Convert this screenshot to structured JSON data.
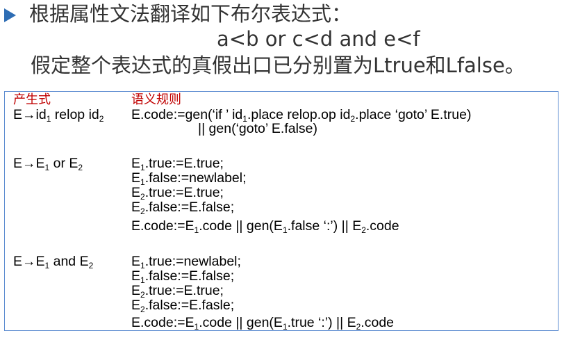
{
  "title": {
    "line1": "根据属性文法翻译如下布尔表达式：",
    "line2": "a<b or c<d and e<f",
    "line3": "假定整个表达式的真假出口已分别置为Ltrue和Lfalse。"
  },
  "table": {
    "header_production": "产生式",
    "header_rules": "语义规则",
    "rows": [
      {
        "production": {
          "a": "E→id",
          "s1": "1",
          "b": " relop id",
          "s2": "2"
        },
        "rules": [
          {
            "a": "E.code:=gen(‘if ’ id",
            "s1": "1",
            "b": ".place relop.op id",
            "s2": "2",
            "c": ".place ‘goto’ E.true)"
          },
          {
            "a": "|| gen(‘goto’  E.false)"
          }
        ]
      },
      {
        "production": {
          "a": "E→E",
          "s1": "1",
          "b": " or E",
          "s2": "2"
        },
        "rules": [
          {
            "a": "E",
            "s1": "1",
            "b": ".true:=E.true;"
          },
          {
            "a": "E",
            "s1": "1",
            "b": ".false:=newlabel;"
          },
          {
            "a": "E",
            "s1": "2",
            "b": ".true:=E.true;"
          },
          {
            "a": "E",
            "s1": "2",
            "b": ".false:=E.false;"
          },
          {
            "a": "E.code:=E",
            "s1": "1",
            "b": ".code || gen(E",
            "s2": "1",
            "c": ".false ‘:’) || E",
            "s3": "2",
            "d": ".code"
          }
        ]
      },
      {
        "production": {
          "a": "E→E",
          "s1": "1",
          "b": " and E",
          "s2": "2"
        },
        "rules": [
          {
            "a": "E",
            "s1": "1",
            "b": ".true:=newlabel;"
          },
          {
            "a": "E",
            "s1": "1",
            "b": ".false:=E.false;"
          },
          {
            "a": "E",
            "s1": "2",
            "b": ".true:=E.true;"
          },
          {
            "a": "E",
            "s1": "2",
            "b": ".false:=E.fasle;"
          },
          {
            "a": "E.code:=E",
            "s1": "1",
            "b": ".code ||  gen(E",
            "s2": "1",
            "c": ".true ‘:’) || E",
            "s3": "2",
            "d": ".code"
          }
        ]
      }
    ]
  }
}
